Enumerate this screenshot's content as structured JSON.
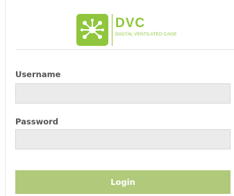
{
  "brand": {
    "name": "DVC",
    "tagline": "DIGITAL VENTILATED CAGE",
    "color": "#8fc63d"
  },
  "form": {
    "username_label": "Username",
    "username_value": "",
    "password_label": "Password",
    "password_value": "",
    "login_label": "Login",
    "button_color": "#b1c97a"
  }
}
